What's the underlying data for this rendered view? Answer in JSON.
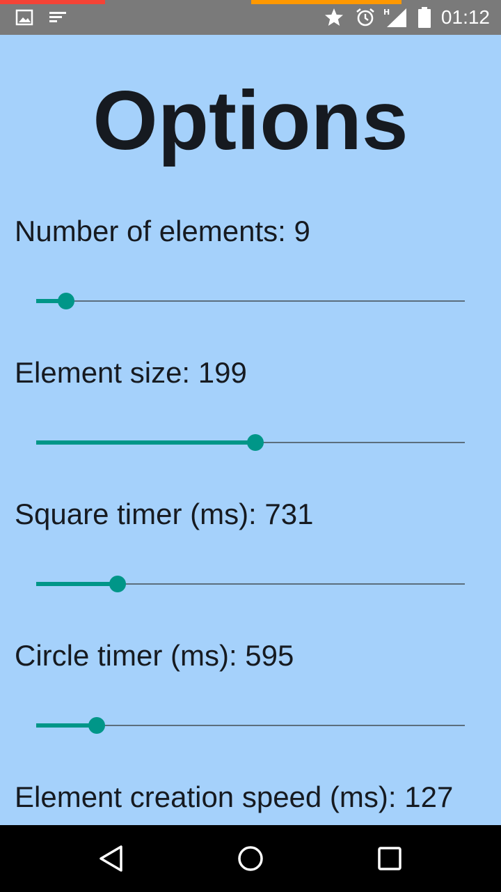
{
  "status_bar": {
    "time": "01:12",
    "icons": [
      "image-icon",
      "notes-icon",
      "star-icon",
      "alarm-icon",
      "signal-h-icon",
      "battery-icon"
    ]
  },
  "page": {
    "title": "Options"
  },
  "options": [
    {
      "label": "Number of elements: 9",
      "level": 0.07
    },
    {
      "label": "Element size: 199",
      "level": 0.512
    },
    {
      "label": "Square timer (ms): 731",
      "level": 0.19
    },
    {
      "label": "Circle timer (ms): 595",
      "level": 0.142
    },
    {
      "label": "Element creation speed (ms): 127"
    }
  ],
  "navigation": {
    "buttons": [
      "back-icon",
      "home-icon",
      "recents-icon"
    ]
  },
  "colors": {
    "background": "#a5d1fb",
    "accent": "#009688",
    "text": "#161a20"
  }
}
